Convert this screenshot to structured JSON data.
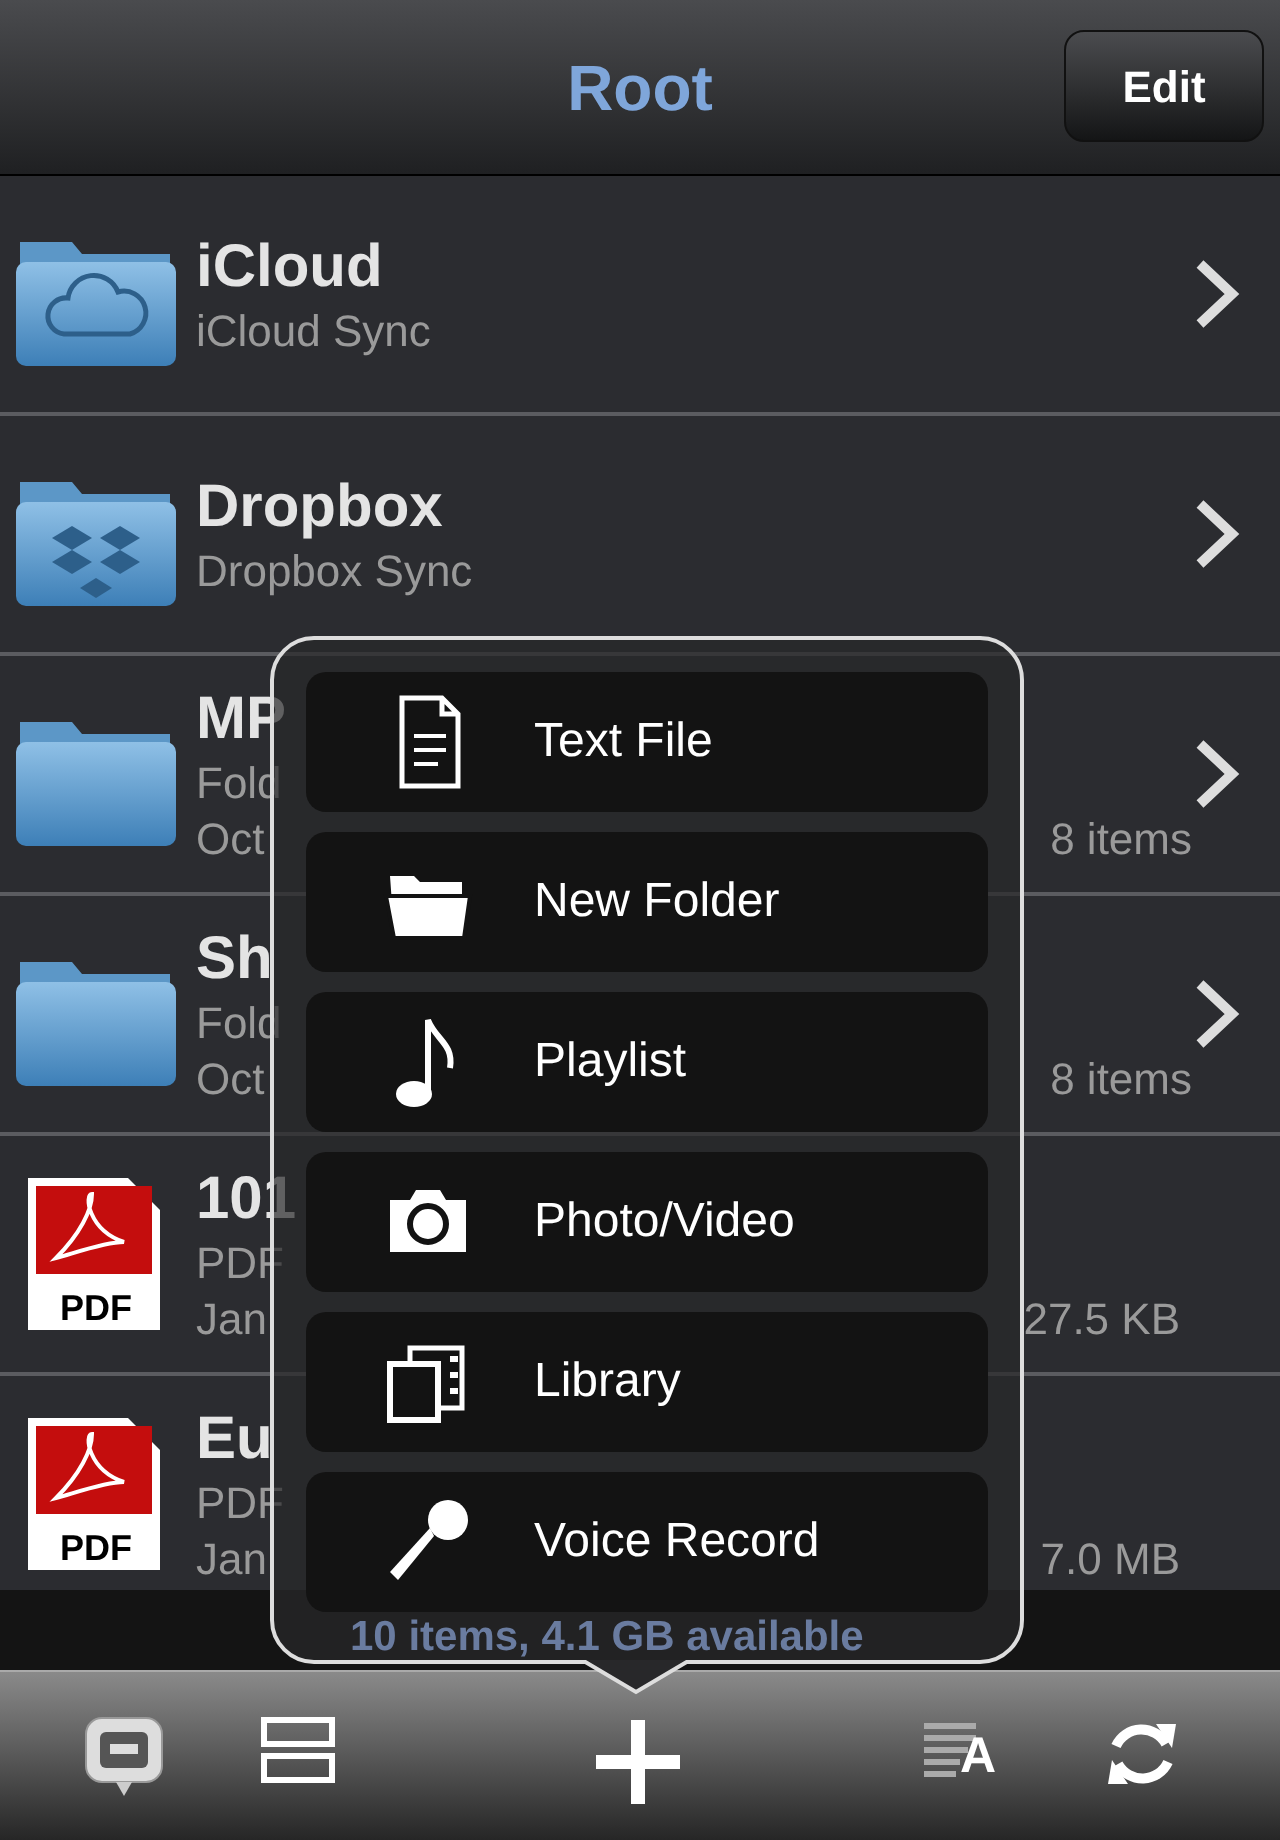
{
  "nav_bar": {
    "title": "Root",
    "edit_button": "Edit"
  },
  "files": [
    {
      "kind": "icloud",
      "name": "iCloud",
      "subtitle": "iCloud Sync",
      "chevron": true
    },
    {
      "kind": "dropbox",
      "name": "Dropbox",
      "subtitle": "Dropbox Sync",
      "chevron": true
    },
    {
      "kind": "folder",
      "name": "MP",
      "subtitle": "Fold",
      "date": "Oct",
      "size": "8 items",
      "chevron": true
    },
    {
      "kind": "folder",
      "name": "Sh",
      "subtitle": "Fold",
      "date": "Oct",
      "size": "8 items",
      "chevron": true
    },
    {
      "kind": "pdf",
      "icon_label": "PDF",
      "name": "101",
      "subtitle": "PDF",
      "date": "Jan",
      "size": "27.5 KB",
      "chevron": false
    },
    {
      "kind": "pdf",
      "icon_label": "PDF",
      "name": "Eu",
      "subtitle": "PDF",
      "date": "Jan",
      "size": "7.0 MB",
      "chevron": false
    }
  ],
  "status": "10 items, 4.1 GB available",
  "add_menu": [
    {
      "kind": "text",
      "label": "Text File"
    },
    {
      "kind": "folder",
      "label": "New Folder"
    },
    {
      "kind": "note",
      "label": "Playlist"
    },
    {
      "kind": "camera",
      "label": "Photo/Video"
    },
    {
      "kind": "library",
      "label": "Library"
    },
    {
      "kind": "mic",
      "label": "Voice Record"
    }
  ],
  "toolbar": [
    {
      "kind": "comment"
    },
    {
      "kind": "list"
    },
    {
      "kind": "add"
    },
    {
      "kind": "sort",
      "label": "A"
    },
    {
      "kind": "refresh"
    }
  ]
}
